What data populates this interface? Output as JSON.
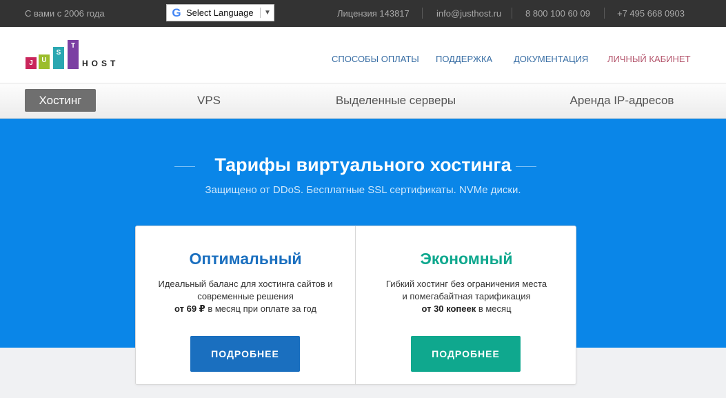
{
  "topbar": {
    "since": "С вами с 2006 года",
    "language": {
      "label": "Select Language",
      "icon": "google-icon"
    },
    "license": "Лицензия 143817",
    "email": "info@justhost.ru",
    "phone_free": "8 800 100 60 09",
    "phone": "+7 495 668 0903"
  },
  "logo": {
    "letters": [
      "J",
      "U",
      "S",
      "T"
    ],
    "word": "HOST",
    "colors": [
      "#c9255b",
      "#9bbd2c",
      "#2aa7b1",
      "#7b3fa3"
    ]
  },
  "nav": {
    "payment": "СПОСОБЫ ОПЛАТЫ",
    "support": "ПОДДЕРЖКА",
    "docs": "ДОКУМЕНТАЦИЯ",
    "cabinet": "ЛИЧНЫЙ КАБИНЕТ"
  },
  "tabs": {
    "hosting": "Хостинг",
    "vps": "VPS",
    "dedicated": "Выделенные серверы",
    "ip": "Аренда IP-адресов"
  },
  "hero": {
    "title": "Тарифы виртуального хостинга",
    "subtitle": "Защищено от DDoS. Бесплатные SSL сертификаты. NVMe диски."
  },
  "plans": [
    {
      "name": "Оптимальный",
      "color": "#1a6fbf",
      "desc1": "Идеальный баланс для хостинга сайтов и",
      "desc2": "современные решения",
      "price": "от 69 ₽",
      "price_suffix": " в месяц при оплате за год",
      "button": "ПОДРОБНЕЕ"
    },
    {
      "name": "Экономный",
      "color": "#0fa88e",
      "desc1": "Гибкий хостинг без ограничения места",
      "desc2": "и помегабайтная тарификация",
      "price": "от 30 копеек",
      "price_suffix": " в месяц",
      "button": "ПОДРОБНЕЕ"
    }
  ]
}
